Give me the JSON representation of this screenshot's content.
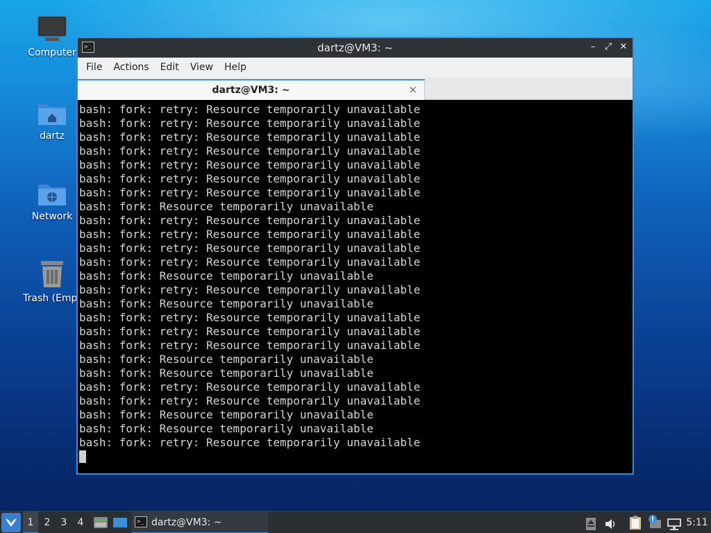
{
  "desktop": {
    "icons": [
      {
        "label": "Computer",
        "icon": "computer-icon"
      },
      {
        "label": "dartz",
        "icon": "home-folder-icon"
      },
      {
        "label": "Network",
        "icon": "network-folder-icon"
      },
      {
        "label": "Trash (Empt",
        "icon": "trash-icon"
      }
    ]
  },
  "window": {
    "title": "dartz@VM3: ~",
    "menu": [
      "File",
      "Actions",
      "Edit",
      "View",
      "Help"
    ],
    "tab_title": "dartz@VM3: ~",
    "tab_close": "×",
    "controls": {
      "minimize": "–",
      "maximize": "⤢",
      "close": "✕"
    }
  },
  "terminal": {
    "lines": [
      "bash: fork: retry: Resource temporarily unavailable",
      "bash: fork: retry: Resource temporarily unavailable",
      "bash: fork: retry: Resource temporarily unavailable",
      "bash: fork: retry: Resource temporarily unavailable",
      "bash: fork: retry: Resource temporarily unavailable",
      "bash: fork: retry: Resource temporarily unavailable",
      "bash: fork: retry: Resource temporarily unavailable",
      "bash: fork: Resource temporarily unavailable",
      "bash: fork: retry: Resource temporarily unavailable",
      "bash: fork: retry: Resource temporarily unavailable",
      "bash: fork: retry: Resource temporarily unavailable",
      "bash: fork: retry: Resource temporarily unavailable",
      "bash: fork: Resource temporarily unavailable",
      "bash: fork: retry: Resource temporarily unavailable",
      "bash: fork: Resource temporarily unavailable",
      "bash: fork: retry: Resource temporarily unavailable",
      "bash: fork: retry: Resource temporarily unavailable",
      "bash: fork: retry: Resource temporarily unavailable",
      "bash: fork: Resource temporarily unavailable",
      "bash: fork: Resource temporarily unavailable",
      "bash: fork: retry: Resource temporarily unavailable",
      "bash: fork: retry: Resource temporarily unavailable",
      "bash: fork: Resource temporarily unavailable",
      "bash: fork: Resource temporarily unavailable",
      "bash: fork: retry: Resource temporarily unavailable"
    ]
  },
  "taskbar": {
    "workspaces": [
      "1",
      "2",
      "3",
      "4"
    ],
    "active_workspace": "1",
    "task_label": "dartz@VM3: ~",
    "clock": "5:11",
    "tray_icons": [
      "eject-icon",
      "volume-icon",
      "clipboard-icon",
      "notification-icon",
      "network-icon"
    ]
  },
  "colors": {
    "accent": "#3a8fd6",
    "terminal_bg": "#000000",
    "terminal_fg": "#d8d8d8",
    "taskbar_bg": "#2b2e33"
  }
}
